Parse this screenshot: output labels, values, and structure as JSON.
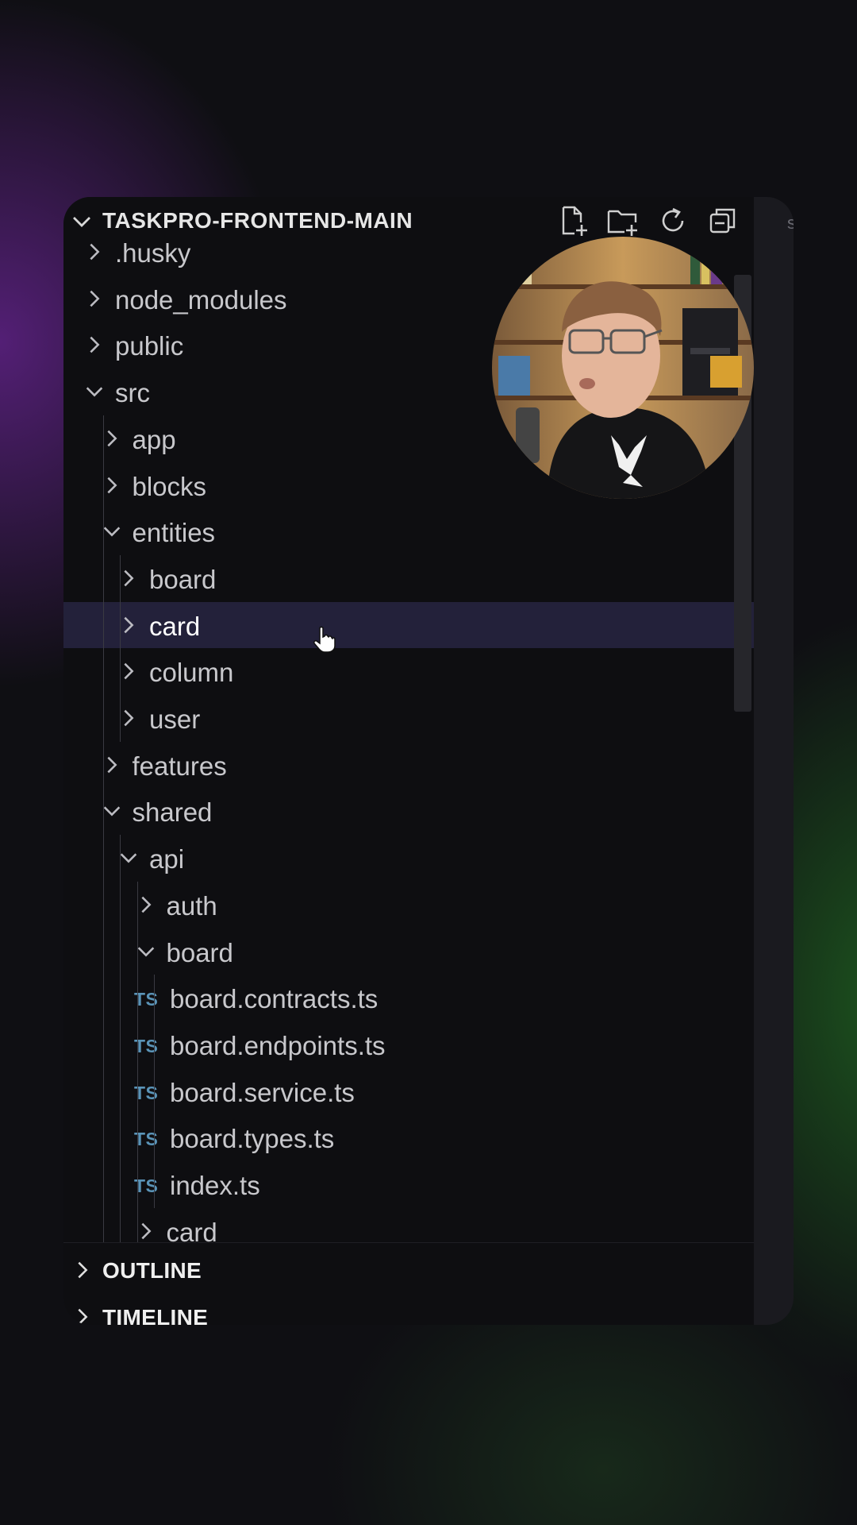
{
  "explorer": {
    "title": "TASKPRO-FRONTEND-MAIN",
    "actions": [
      {
        "name": "new-file-icon"
      },
      {
        "name": "new-folder-icon"
      },
      {
        "name": "refresh-icon"
      },
      {
        "name": "collapse-all-icon"
      }
    ],
    "side_hint": "s"
  },
  "tree": [
    {
      "label": ".husky",
      "type": "folder",
      "depth": 1,
      "expanded": false
    },
    {
      "label": "node_modules",
      "type": "folder",
      "depth": 1,
      "expanded": false
    },
    {
      "label": "public",
      "type": "folder",
      "depth": 1,
      "expanded": false
    },
    {
      "label": "src",
      "type": "folder",
      "depth": 1,
      "expanded": true
    },
    {
      "label": "app",
      "type": "folder",
      "depth": 2,
      "expanded": false
    },
    {
      "label": "blocks",
      "type": "folder",
      "depth": 2,
      "expanded": false
    },
    {
      "label": "entities",
      "type": "folder",
      "depth": 2,
      "expanded": true
    },
    {
      "label": "board",
      "type": "folder",
      "depth": 3,
      "expanded": false
    },
    {
      "label": "card",
      "type": "folder",
      "depth": 3,
      "expanded": false,
      "selected": true
    },
    {
      "label": "column",
      "type": "folder",
      "depth": 3,
      "expanded": false
    },
    {
      "label": "user",
      "type": "folder",
      "depth": 3,
      "expanded": false
    },
    {
      "label": "features",
      "type": "folder",
      "depth": 2,
      "expanded": false
    },
    {
      "label": "shared",
      "type": "folder",
      "depth": 2,
      "expanded": true
    },
    {
      "label": "api",
      "type": "folder",
      "depth": 3,
      "expanded": true
    },
    {
      "label": "auth",
      "type": "folder",
      "depth": 4,
      "expanded": false
    },
    {
      "label": "board",
      "type": "folder",
      "depth": 4,
      "expanded": true
    },
    {
      "label": "board.contracts.ts",
      "type": "file",
      "badge": "TS",
      "depth": 5
    },
    {
      "label": "board.endpoints.ts",
      "type": "file",
      "badge": "TS",
      "depth": 5
    },
    {
      "label": "board.service.ts",
      "type": "file",
      "badge": "TS",
      "depth": 5
    },
    {
      "label": "board.types.ts",
      "type": "file",
      "badge": "TS",
      "depth": 5
    },
    {
      "label": "index.ts",
      "type": "file",
      "badge": "TS",
      "depth": 5
    },
    {
      "label": "card",
      "type": "folder",
      "depth": 4,
      "expanded": false
    }
  ],
  "sections": [
    {
      "label": "OUTLINE"
    },
    {
      "label": "TIMELINE"
    }
  ],
  "colors": {
    "selection": "#23213a",
    "ts_badge": "#5a94b8",
    "text": "#c8c8cc"
  }
}
